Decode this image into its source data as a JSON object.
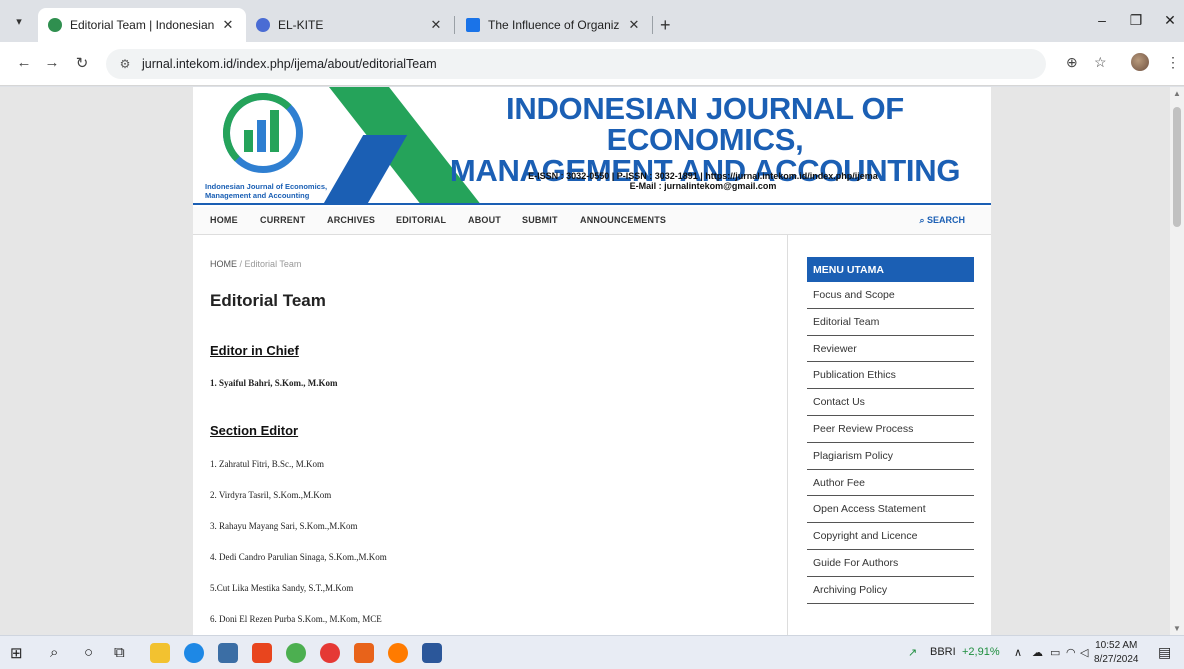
{
  "browser": {
    "tabs": [
      {
        "title": "Editorial Team | Indonesian Jour",
        "active": true,
        "favicon_color": "#2f8f4f"
      },
      {
        "title": "EL-KITE",
        "active": false,
        "favicon_color": "#4a6cd4"
      },
      {
        "title": "The Influence of Organizational",
        "active": false,
        "favicon_color": "#1a73e8"
      }
    ],
    "new_tab": "+",
    "url": "jurnal.intekom.id/index.php/ijema/about/editorialTeam"
  },
  "header": {
    "logo_caption_1": "Indonesian Journal of Economics,",
    "logo_caption_2": "Management and Accounting",
    "title_line1": "INDONESIAN JOURNAL OF ECONOMICS,",
    "title_line2": "MANAGEMENT AND ACCOUNTING",
    "info_line1": "E-ISSN : 3032-0550 | P-ISSN : 3032-1891 | https://jurnal.intekom.id/index.php/ijema",
    "info_line2": "E-Mail : jurnalintekom@gmail.com",
    "brand_blue": "#1b5fb4",
    "brand_green": "#25a35a"
  },
  "nav": {
    "items": [
      "HOME",
      "CURRENT",
      "ARCHIVES",
      "EDITORIAL",
      "ABOUT",
      "SUBMIT",
      "ANNOUNCEMENTS"
    ],
    "search": "SEARCH"
  },
  "main": {
    "breadcrumb_home": "HOME",
    "breadcrumb_sep": "/",
    "breadcrumb_current": "Editorial Team",
    "page_title": "Editorial Team",
    "editor_in_chief_heading": "Editor in Chief",
    "editor_in_chief": "1.  Syaiful Bahri, S.Kom., M.Kom",
    "section_editor_heading": "Section Editor",
    "section_editors": [
      "1. Zahratul Fitri, B.Sc., M.Kom",
      "2. Virdyra Tasril, S.Kom.,M.Kom",
      "3. Rahayu Mayang Sari, S.Kom.,M.Kom",
      "4. Dedi Candro Parulian Sinaga, S.Kom.,M.Kom",
      "5.Cut Lika Mestika Sandy, S.T.,M.Kom",
      "6. Doni El Rezen Purba S.Kom., M.Kom, MCE"
    ]
  },
  "sidebar": {
    "heading": "MENU UTAMA",
    "items": [
      "Focus and Scope",
      "Editorial Team",
      "Reviewer",
      "Publication Ethics",
      "Contact Us",
      "Peer Review Process",
      "Plagiarism Policy",
      "Author Fee",
      "Open Access Statement",
      "Copyright and Licence",
      "Guide For Authors",
      "Archiving Policy"
    ]
  },
  "taskbar": {
    "stock_symbol": "BBRI",
    "stock_change": "+2,91%",
    "time": "10:52 AM",
    "date": "8/27/2024"
  }
}
